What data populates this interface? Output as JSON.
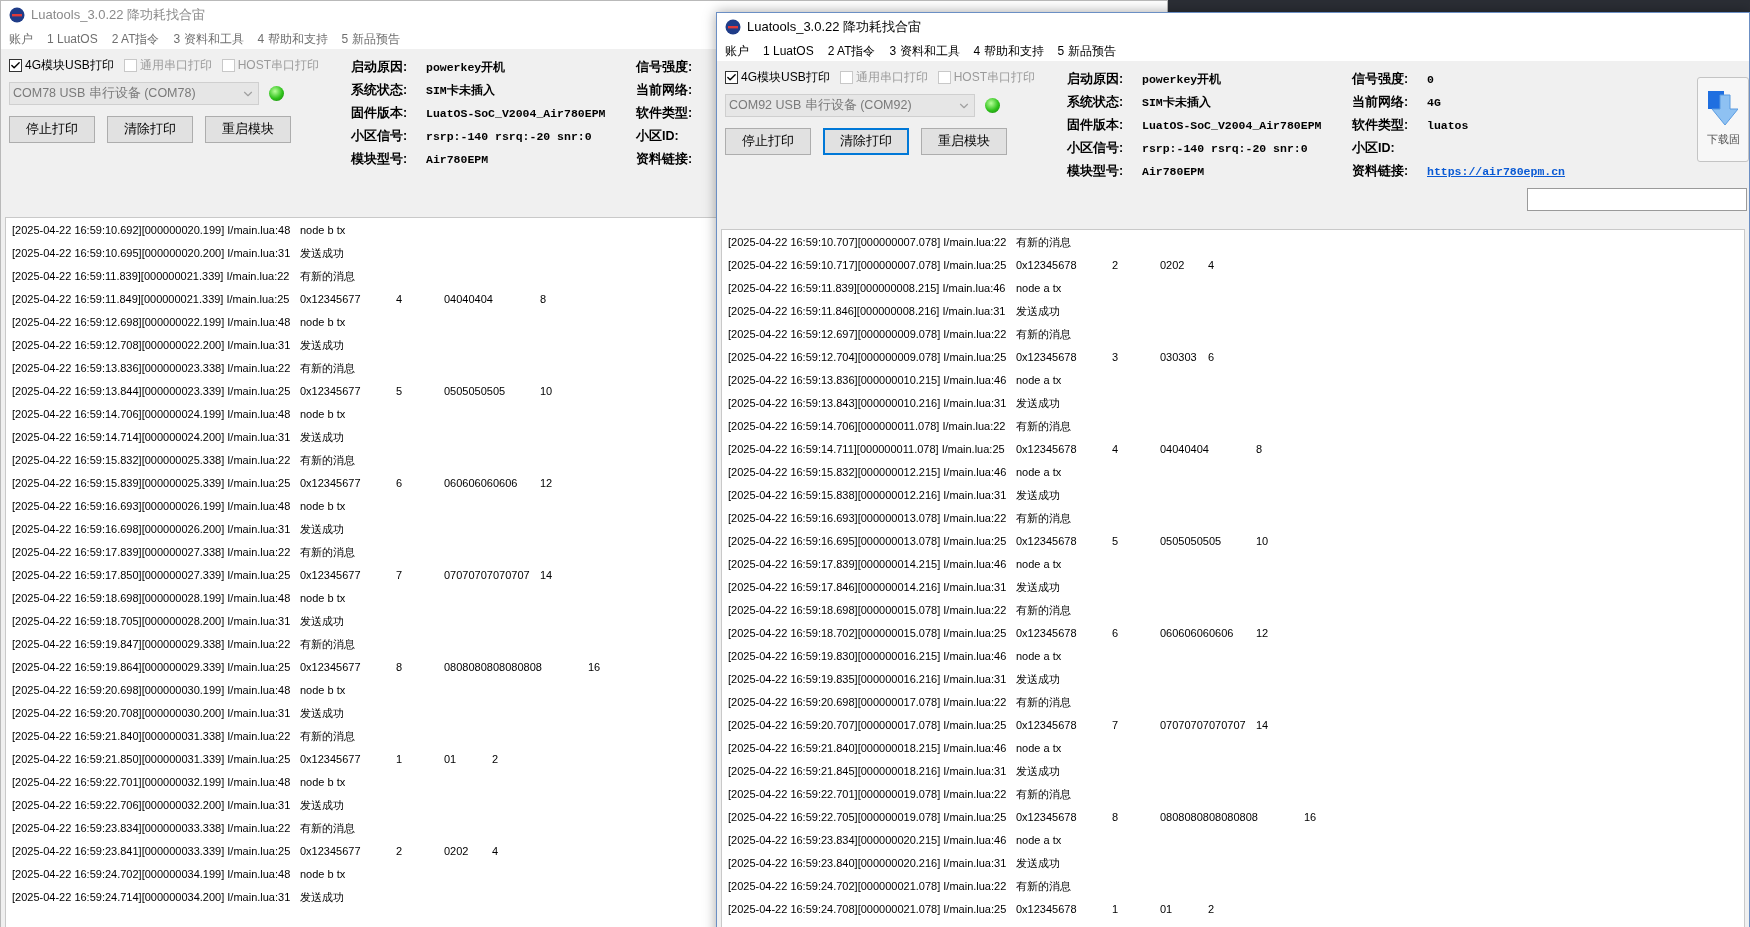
{
  "windows": [
    {
      "title": "Luatools_3.0.22 降功耗找合宙",
      "active": false,
      "menu": [
        "账户",
        "1 LuatOS",
        "2 AT指令",
        "3 资料和工具",
        "4 帮助和支持",
        "5 新品预告"
      ],
      "print_options": [
        {
          "label": "4G模块USB打印",
          "checked": true,
          "disabled": false
        },
        {
          "label": "通用串口打印",
          "checked": false,
          "disabled": true
        },
        {
          "label": "HOST串口打印",
          "checked": false,
          "disabled": true
        }
      ],
      "port": {
        "value": "COM78 USB 串行设备 (COM78)",
        "disabled": true
      },
      "connected": true,
      "buttons": [
        {
          "label": "停止打印",
          "focused": false
        },
        {
          "label": "清除打印",
          "focused": false
        },
        {
          "label": "重启模块",
          "focused": false
        }
      ],
      "info_left": [
        {
          "label": "启动原因:",
          "value": "powerkey开机"
        },
        {
          "label": "系统状态:",
          "value": "SIM卡未插入"
        },
        {
          "label": "固件版本:",
          "value": "LuatOS-SoC_V2004_Air780EPM"
        },
        {
          "label": "小区信号:",
          "value": "rsrp:-140 rsrq:-20 snr:0"
        },
        {
          "label": "模块型号:",
          "value": "Air780EPM"
        }
      ],
      "info_right": [
        {
          "label": "信号强度:"
        },
        {
          "label": "当前网络:"
        },
        {
          "label": "软件类型:"
        },
        {
          "label": "小区ID:"
        },
        {
          "label": "资料链接:"
        }
      ],
      "log": [
        [
          "[2025-04-22 16:59:10.692][000000020.199] I/main.lua:48",
          "node b tx"
        ],
        [
          "[2025-04-22 16:59:10.695][000000020.200] I/main.lua:31",
          "发送成功"
        ],
        [
          "[2025-04-22 16:59:11.839][000000021.339] I/main.lua:22",
          "有新的消息"
        ],
        [
          "[2025-04-22 16:59:11.849][000000021.339] I/main.lua:25",
          "0x12345677",
          "4",
          "04040404",
          "8"
        ],
        [
          "[2025-04-22 16:59:12.698][000000022.199] I/main.lua:48",
          "node b tx"
        ],
        [
          "[2025-04-22 16:59:12.708][000000022.200] I/main.lua:31",
          "发送成功"
        ],
        [
          "[2025-04-22 16:59:13.836][000000023.338] I/main.lua:22",
          "有新的消息"
        ],
        [
          "[2025-04-22 16:59:13.844][000000023.339] I/main.lua:25",
          "0x12345677",
          "5",
          "0505050505",
          "10"
        ],
        [
          "[2025-04-22 16:59:14.706][000000024.199] I/main.lua:48",
          "node b tx"
        ],
        [
          "[2025-04-22 16:59:14.714][000000024.200] I/main.lua:31",
          "发送成功"
        ],
        [
          "[2025-04-22 16:59:15.832][000000025.338] I/main.lua:22",
          "有新的消息"
        ],
        [
          "[2025-04-22 16:59:15.839][000000025.339] I/main.lua:25",
          "0x12345677",
          "6",
          "060606060606",
          "12"
        ],
        [
          "[2025-04-22 16:59:16.693][000000026.199] I/main.lua:48",
          "node b tx"
        ],
        [
          "[2025-04-22 16:59:16.698][000000026.200] I/main.lua:31",
          "发送成功"
        ],
        [
          "[2025-04-22 16:59:17.839][000000027.338] I/main.lua:22",
          "有新的消息"
        ],
        [
          "[2025-04-22 16:59:17.850][000000027.339] I/main.lua:25",
          "0x12345677",
          "7",
          "07070707070707",
          "14"
        ],
        [
          "[2025-04-22 16:59:18.698][000000028.199] I/main.lua:48",
          "node b tx"
        ],
        [
          "[2025-04-22 16:59:18.705][000000028.200] I/main.lua:31",
          "发送成功"
        ],
        [
          "[2025-04-22 16:59:19.847][000000029.338] I/main.lua:22",
          "有新的消息"
        ],
        [
          "[2025-04-22 16:59:19.864][000000029.339] I/main.lua:25",
          "0x12345677",
          "8",
          "0808080808080808",
          "16"
        ],
        [
          "[2025-04-22 16:59:20.698][000000030.199] I/main.lua:48",
          "node b tx"
        ],
        [
          "[2025-04-22 16:59:20.708][000000030.200] I/main.lua:31",
          "发送成功"
        ],
        [
          "[2025-04-22 16:59:21.840][000000031.338] I/main.lua:22",
          "有新的消息"
        ],
        [
          "[2025-04-22 16:59:21.850][000000031.339] I/main.lua:25",
          "0x12345677",
          "1",
          "01",
          "2"
        ],
        [
          "[2025-04-22 16:59:22.701][000000032.199] I/main.lua:48",
          "node b tx"
        ],
        [
          "[2025-04-22 16:59:22.706][000000032.200] I/main.lua:31",
          "发送成功"
        ],
        [
          "[2025-04-22 16:59:23.834][000000033.338] I/main.lua:22",
          "有新的消息"
        ],
        [
          "[2025-04-22 16:59:23.841][000000033.339] I/main.lua:25",
          "0x12345677",
          "2",
          "0202",
          "4"
        ],
        [
          "[2025-04-22 16:59:24.702][000000034.199] I/main.lua:48",
          "node b tx"
        ],
        [
          "[2025-04-22 16:59:24.714][000000034.200] I/main.lua:31",
          "发送成功"
        ]
      ]
    },
    {
      "title": "Luatools_3.0.22 降功耗找合宙",
      "active": true,
      "menu": [
        "账户",
        "1 LuatOS",
        "2 AT指令",
        "3 资料和工具",
        "4 帮助和支持",
        "5 新品预告"
      ],
      "print_options": [
        {
          "label": "4G模块USB打印",
          "checked": true,
          "disabled": false
        },
        {
          "label": "通用串口打印",
          "checked": false,
          "disabled": true
        },
        {
          "label": "HOST串口打印",
          "checked": false,
          "disabled": true
        }
      ],
      "port": {
        "value": "COM92 USB 串行设备 (COM92)",
        "disabled": true
      },
      "connected": true,
      "buttons": [
        {
          "label": "停止打印",
          "focused": false
        },
        {
          "label": "清除打印",
          "focused": true
        },
        {
          "label": "重启模块",
          "focused": false
        }
      ],
      "info_left": [
        {
          "label": "启动原因:",
          "value": "powerkey开机"
        },
        {
          "label": "系统状态:",
          "value": "SIM卡未插入"
        },
        {
          "label": "固件版本:",
          "value": "LuatOS-SoC_V2004_Air780EPM"
        },
        {
          "label": "小区信号:",
          "value": "rsrp:-140 rsrq:-20 snr:0"
        },
        {
          "label": "模块型号:",
          "value": "Air780EPM"
        }
      ],
      "info_right": [
        {
          "label": "信号强度:",
          "value": "0"
        },
        {
          "label": "当前网络:",
          "value": "4G"
        },
        {
          "label": "软件类型:",
          "value": "luatos"
        },
        {
          "label": "小区ID:"
        },
        {
          "label": "资料链接:",
          "value": "https://air780epm.cn",
          "link": true
        }
      ],
      "download_button": {
        "label": "下载固"
      },
      "log": [
        [
          "[2025-04-22 16:59:10.707][000000007.078] I/main.lua:22",
          "有新的消息"
        ],
        [
          "[2025-04-22 16:59:10.717][000000007.078] I/main.lua:25",
          "0x12345678",
          "2",
          "0202",
          "4"
        ],
        [
          "[2025-04-22 16:59:11.839][000000008.215] I/main.lua:46",
          "node a tx"
        ],
        [
          "[2025-04-22 16:59:11.846][000000008.216] I/main.lua:31",
          "发送成功"
        ],
        [
          "[2025-04-22 16:59:12.697][000000009.078] I/main.lua:22",
          "有新的消息"
        ],
        [
          "[2025-04-22 16:59:12.704][000000009.078] I/main.lua:25",
          "0x12345678",
          "3",
          "030303",
          "6"
        ],
        [
          "[2025-04-22 16:59:13.836][000000010.215] I/main.lua:46",
          "node a tx"
        ],
        [
          "[2025-04-22 16:59:13.843][000000010.216] I/main.lua:31",
          "发送成功"
        ],
        [
          "[2025-04-22 16:59:14.706][000000011.078] I/main.lua:22",
          "有新的消息"
        ],
        [
          "[2025-04-22 16:59:14.711][000000011.078] I/main.lua:25",
          "0x12345678",
          "4",
          "04040404",
          "8"
        ],
        [
          "[2025-04-22 16:59:15.832][000000012.215] I/main.lua:46",
          "node a tx"
        ],
        [
          "[2025-04-22 16:59:15.838][000000012.216] I/main.lua:31",
          "发送成功"
        ],
        [
          "[2025-04-22 16:59:16.693][000000013.078] I/main.lua:22",
          "有新的消息"
        ],
        [
          "[2025-04-22 16:59:16.695][000000013.078] I/main.lua:25",
          "0x12345678",
          "5",
          "0505050505",
          "10"
        ],
        [
          "[2025-04-22 16:59:17.839][000000014.215] I/main.lua:46",
          "node a tx"
        ],
        [
          "[2025-04-22 16:59:17.846][000000014.216] I/main.lua:31",
          "发送成功"
        ],
        [
          "[2025-04-22 16:59:18.698][000000015.078] I/main.lua:22",
          "有新的消息"
        ],
        [
          "[2025-04-22 16:59:18.702][000000015.078] I/main.lua:25",
          "0x12345678",
          "6",
          "060606060606",
          "12"
        ],
        [
          "[2025-04-22 16:59:19.830][000000016.215] I/main.lua:46",
          "node a tx"
        ],
        [
          "[2025-04-22 16:59:19.835][000000016.216] I/main.lua:31",
          "发送成功"
        ],
        [
          "[2025-04-22 16:59:20.698][000000017.078] I/main.lua:22",
          "有新的消息"
        ],
        [
          "[2025-04-22 16:59:20.707][000000017.078] I/main.lua:25",
          "0x12345678",
          "7",
          "07070707070707",
          "14"
        ],
        [
          "[2025-04-22 16:59:21.840][000000018.215] I/main.lua:46",
          "node a tx"
        ],
        [
          "[2025-04-22 16:59:21.845][000000018.216] I/main.lua:31",
          "发送成功"
        ],
        [
          "[2025-04-22 16:59:22.701][000000019.078] I/main.lua:22",
          "有新的消息"
        ],
        [
          "[2025-04-22 16:59:22.705][000000019.078] I/main.lua:25",
          "0x12345678",
          "8",
          "0808080808080808",
          "16"
        ],
        [
          "[2025-04-22 16:59:23.834][000000020.215] I/main.lua:46",
          "node a tx"
        ],
        [
          "[2025-04-22 16:59:23.840][000000020.216] I/main.lua:31",
          "发送成功"
        ],
        [
          "[2025-04-22 16:59:24.702][000000021.078] I/main.lua:22",
          "有新的消息"
        ],
        [
          "[2025-04-22 16:59:24.708][000000021.078] I/main.lua:25",
          "0x12345678",
          "1",
          "01",
          "2"
        ]
      ]
    }
  ]
}
